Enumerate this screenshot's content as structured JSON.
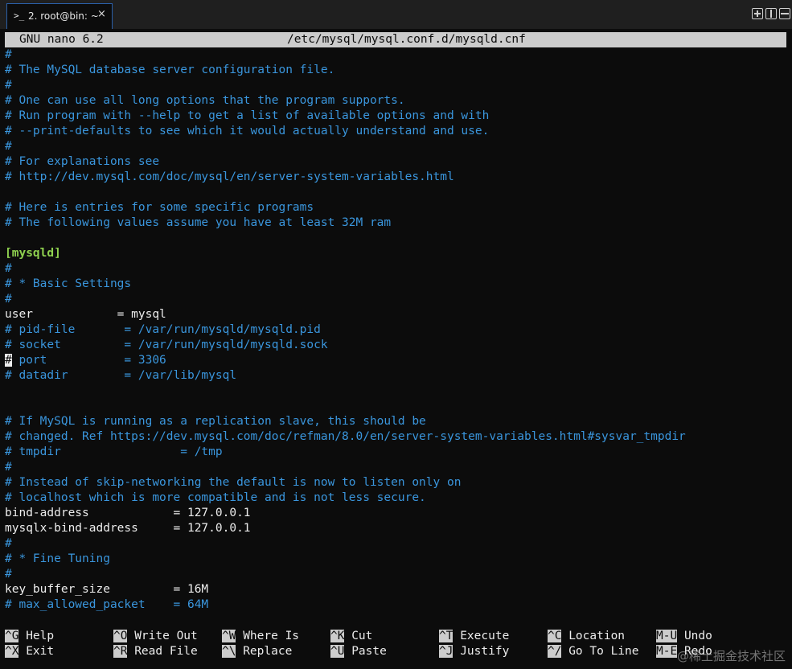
{
  "tab": {
    "prompt_glyph": ">_",
    "title": "2. root@bin: ~",
    "close_glyph": "×"
  },
  "nano": {
    "version": "GNU nano 6.2",
    "filename": "/etc/mysql/mysql.conf.d/mysqld.cnf"
  },
  "lines": [
    "#",
    "# The MySQL database server configuration file.",
    "#",
    "# One can use all long options that the program supports.",
    "# Run program with --help to get a list of available options and with",
    "# --print-defaults to see which it would actually understand and use.",
    "#",
    "# For explanations see",
    "# http://dev.mysql.com/doc/mysql/en/server-system-variables.html",
    "",
    "# Here is entries for some specific programs",
    "# The following values assume you have at least 32M ram",
    "",
    "[mysqld]",
    "#",
    "# * Basic Settings",
    "#",
    "user            = mysql",
    "# pid-file       = /var/run/mysqld/mysqld.pid",
    "# socket         = /var/run/mysqld/mysqld.sock",
    "# port           = 3306",
    "# datadir        = /var/lib/mysql",
    "",
    "",
    "# If MySQL is running as a replication slave, this should be",
    "# changed. Ref https://dev.mysql.com/doc/refman/8.0/en/server-system-variables.html#sysvar_tmpdir",
    "# tmpdir                 = /tmp",
    "#",
    "# Instead of skip-networking the default is now to listen only on",
    "# localhost which is more compatible and is not less secure.",
    "bind-address            = 127.0.0.1",
    "mysqlx-bind-address     = 127.0.0.1",
    "#",
    "# * Fine Tuning",
    "#",
    "key_buffer_size         = 16M",
    "# max_allowed_packet    = 64M"
  ],
  "shortcuts": [
    {
      "key": "^G",
      "label": "Help"
    },
    {
      "key": "^O",
      "label": "Write Out"
    },
    {
      "key": "^W",
      "label": "Where Is"
    },
    {
      "key": "^K",
      "label": "Cut"
    },
    {
      "key": "^T",
      "label": "Execute"
    },
    {
      "key": "^C",
      "label": "Location"
    },
    {
      "key": "M-U",
      "label": "Undo"
    },
    {
      "key": "^X",
      "label": "Exit"
    },
    {
      "key": "^R",
      "label": "Read File"
    },
    {
      "key": "^\\",
      "label": "Replace"
    },
    {
      "key": "^U",
      "label": "Paste"
    },
    {
      "key": "^J",
      "label": "Justify"
    },
    {
      "key": "^/",
      "label": "Go To Line"
    },
    {
      "key": "M-E",
      "label": "Redo"
    }
  ],
  "watermark": "@稀土掘金技术社区",
  "colors": {
    "comment": "#3a96dd",
    "section": "#8fd14f",
    "text": "#ececec",
    "background": "#0c0c0c"
  }
}
